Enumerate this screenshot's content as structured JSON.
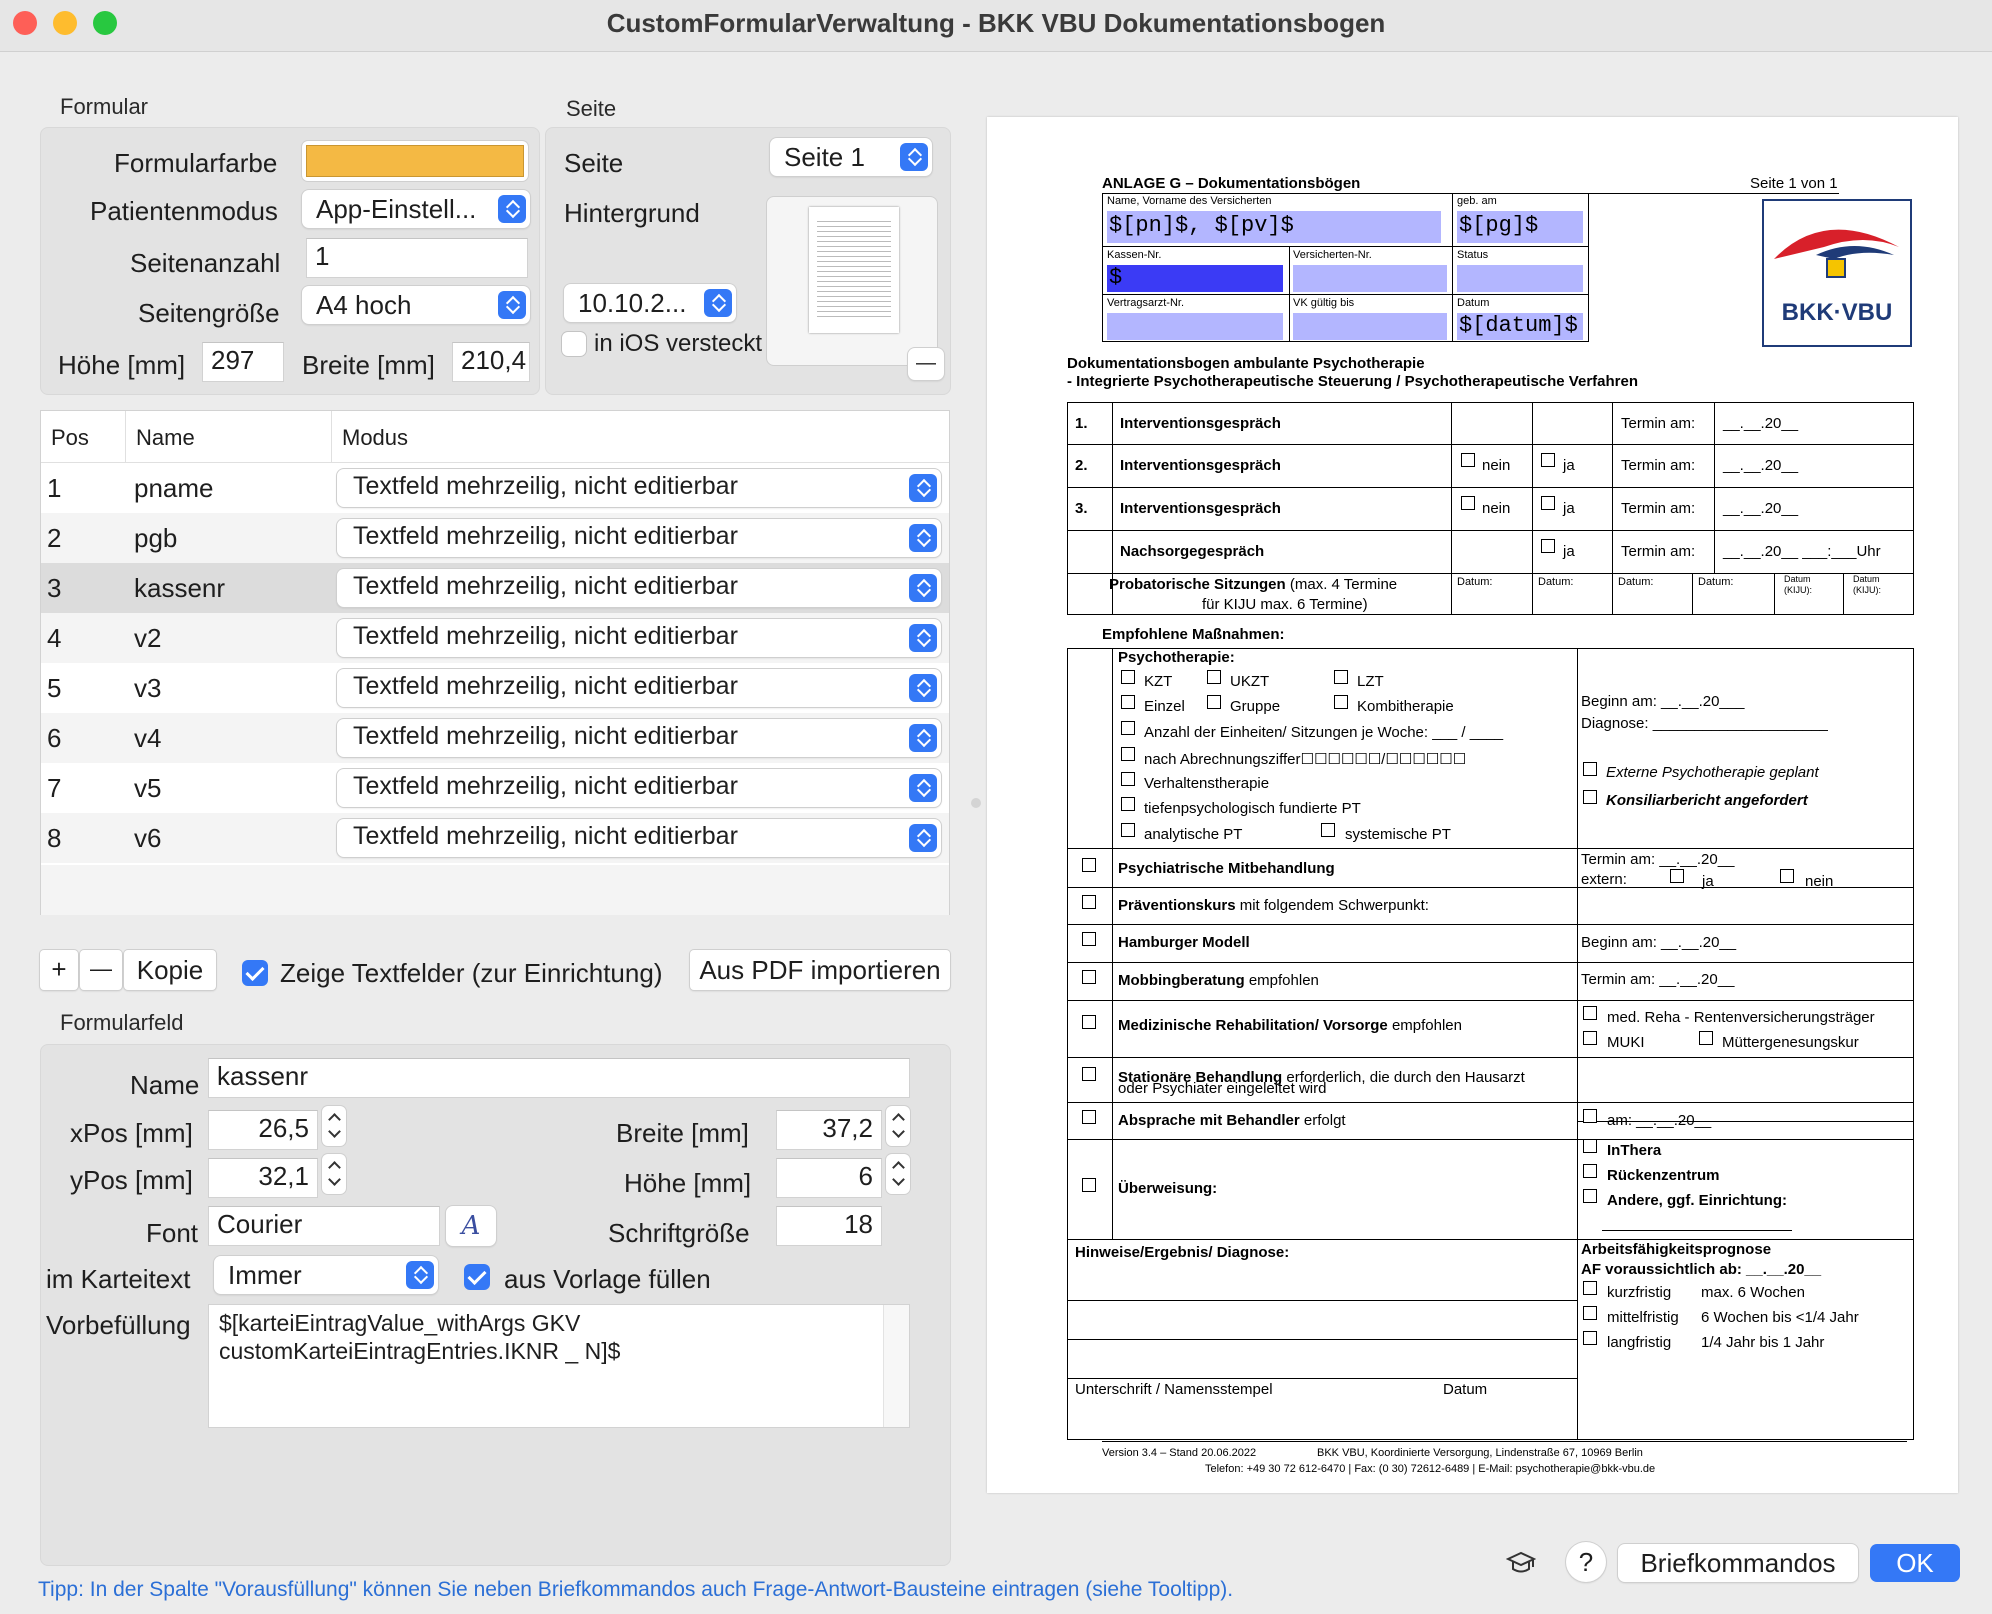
{
  "window": {
    "title": "CustomFormularVerwaltung - BKK VBU Dokumentationsbogen"
  },
  "formular": {
    "section_label": "Formular",
    "farbe_label": "Formularfarbe",
    "farbe_color": "#f4b944",
    "patientenmodus_label": "Patientenmodus",
    "patientenmodus_value": "App-Einstell...",
    "seitenanzahl_label": "Seitenanzahl",
    "seitenanzahl_value": "1",
    "seitengroesse_label": "Seitengröße",
    "seitengroesse_value": "A4 hoch",
    "hoehe_label": "Höhe [mm]",
    "hoehe_value": "297",
    "breite_label": "Breite [mm]",
    "breite_value": "210,4"
  },
  "seite": {
    "section_label": "Seite",
    "seite_label": "Seite",
    "seite_value": "Seite 1",
    "hintergrund_label": "Hintergrund",
    "date_value": "10.10.2...",
    "ios_label": "in iOS versteckt",
    "remove_symbol": "—"
  },
  "table": {
    "headers": {
      "pos": "Pos",
      "name": "Name",
      "modus": "Modus"
    },
    "rows": [
      {
        "pos": "1",
        "name": "pname",
        "modus": "Textfeld mehrzeilig, nicht editierbar"
      },
      {
        "pos": "2",
        "name": "pgb",
        "modus": "Textfeld mehrzeilig, nicht editierbar"
      },
      {
        "pos": "3",
        "name": "kassenr",
        "modus": "Textfeld mehrzeilig, nicht editierbar"
      },
      {
        "pos": "4",
        "name": "v2",
        "modus": "Textfeld mehrzeilig, nicht editierbar"
      },
      {
        "pos": "5",
        "name": "v3",
        "modus": "Textfeld mehrzeilig, nicht editierbar"
      },
      {
        "pos": "6",
        "name": "v4",
        "modus": "Textfeld mehrzeilig, nicht editierbar"
      },
      {
        "pos": "7",
        "name": "v5",
        "modus": "Textfeld mehrzeilig, nicht editierbar"
      },
      {
        "pos": "8",
        "name": "v6",
        "modus": "Textfeld mehrzeilig, nicht editierbar"
      }
    ]
  },
  "toolbar": {
    "add": "+",
    "remove": "—",
    "copy": "Kopie",
    "show_fields": "Zeige Textfelder (zur Einrichtung)",
    "import_pdf": "Aus PDF importieren"
  },
  "feld": {
    "section_label": "Formularfeld",
    "name_label": "Name",
    "name_value": "kassenr",
    "xpos_label": "xPos [mm]",
    "xpos_value": "26,5",
    "ypos_label": "yPos [mm]",
    "ypos_value": "32,1",
    "breite_label": "Breite [mm]",
    "breite_value": "37,2",
    "hoehe_label": "Höhe [mm]",
    "hoehe_value": "6",
    "font_label": "Font",
    "font_value": "Courier",
    "font_button": "A",
    "schrift_label": "Schriftgröße",
    "schrift_value": "18",
    "karteitext_label": "im Karteitext",
    "karteitext_value": "Immer",
    "vorlage_label": "aus Vorlage füllen",
    "vorbefuellung_label": "Vorbefüllung",
    "vorbefuellung_line1": "$[karteiEintragValue_withArgs GKV",
    "vorbefuellung_line2": "customKarteiEintragEntries.IKNR _ N]$"
  },
  "footer": {
    "tip": "Tipp: In der Spalte \"Vorausfüllung\" können Sie neben Briefkommandos auch Frage-Antwort-Bausteine eintragen (siehe Tooltipp).",
    "help": "?",
    "briefkommandos": "Briefkommandos",
    "ok": "OK"
  },
  "pdf": {
    "anlage": "ANLAGE G – Dokumentationsbögen",
    "seite": "Seite 1 von 1",
    "h_name": "Name, Vorname des Versicherten",
    "v_name": "$[pn]$, $[pv]$",
    "h_geb": "geb. am",
    "v_geb": "$[pg]$",
    "h_kassen": "Kassen-Nr.",
    "v_kassen": "$",
    "h_vers": "Versicherten-Nr.",
    "h_status": "Status",
    "h_vertrag": "Vertragsarzt-Nr.",
    "h_vk": "VK gültig bis",
    "h_datum": "Datum",
    "v_datum": "$[datum]$",
    "logo": "BKK·VBU",
    "doc_title1": "Dokumentationsbogen ambulante Psychotherapie",
    "doc_title2": "- Integrierte Psychotherapeutische Steuerung / Psychotherapeutische Verfahren",
    "t1_rows": [
      {
        "n": "1.",
        "t": "Interventionsgespräch"
      },
      {
        "n": "2.",
        "t": "Interventionsgespräch"
      },
      {
        "n": "3.",
        "t": "Interventionsgespräch"
      },
      {
        "n": "",
        "t": "Nachsorgegespräch"
      }
    ],
    "nein": "nein",
    "ja": "ja",
    "termin_am": "Termin am:",
    "termin_val": "__.__.20__",
    "termin_uhr": "__.__.20__ ___:___Uhr",
    "probat_b": "Probatorische Sitzungen",
    "probat_1": "(max. 4 Termine",
    "probat_2": "für KIJU max. 6 Termine)",
    "datum_c": "Datum:",
    "datum_kiju": "Datum",
    "kiju": "(KIJU):",
    "empfohlen": "Empfohlene Maßnahmen:",
    "psycho": "Psychotherapie:",
    "kzt": "KZT",
    "ukzt": "UKZT",
    "lzt": "LZT",
    "einzel": "Einzel",
    "gruppe": "Gruppe",
    "kombi": "Kombitherapie",
    "anzahl": "Anzahl der Einheiten/ Sitzungen je Woche: ___ / ____",
    "abrechnung": "nach Abrechnungsziffer☐☐☐☐☐☐/☐☐☐☐☐☐",
    "verhalten": "Verhaltenstherapie",
    "tiefen": "tiefenpsychologisch fundierte PT",
    "analyt": "analytische PT",
    "system": "systemische PT",
    "beginn": "Beginn am: __.__.20___",
    "diagnose": "Diagnose: _____________________",
    "extern": "Externe Psychotherapie geplant",
    "konsil": "Konsiliarbericht angefordert",
    "psychiat": "Psychiatrische Mitbehandlung",
    "termin_psy": "Termin am: __.__.20__",
    "extern2": "extern:",
    "praevention_b": "Präventionskurs",
    "praevention": "mit folgendem Schwerpunkt:",
    "hamburger": "Hamburger Modell",
    "beginn2": "Beginn am: __.__.20__",
    "mobbing_b": "Mobbingberatung",
    "mobbing": "empfohlen",
    "termin_mob": "Termin am:  __.__.20__",
    "medreha_b": "Medizinische Rehabilitation/ Vorsorge",
    "medreha": "empfohlen",
    "reha_rv": "med. Reha - Rentenversicherungsträger",
    "muki": "MUKI",
    "muetter": "Müttergenesungskur",
    "station_b": "Stationäre Behandlung",
    "station": "erforderlich, die durch den Hausarzt",
    "station2": "oder Psychiater eingeleitet wird",
    "absprache_b": "Absprache mit Behandler",
    "absprache": "erfolgt",
    "am": "am:      __.__.20__",
    "ueberweisung": "Überweisung:",
    "inthera": "InThera",
    "ruecken": "Rückenzentrum",
    "andere": "Andere, ggf. Einrichtung:",
    "hinweise": "Hinweise/Ergebnis/ Diagnose:",
    "arbeit": "Arbeitsfähigkeitsprognose",
    "af": "AF voraussichtlich ab:   __.__.20__",
    "kurz": "kurzfristig",
    "kurz2": "max. 6 Wochen",
    "mittel": "mittelfristig",
    "mittel2": "6 Wochen bis <1/4 Jahr",
    "lang": "langfristig",
    "lang2": "1/4 Jahr bis 1 Jahr",
    "unterschrift": "Unterschrift / Namensstempel",
    "datum_u": "Datum",
    "version": "Version 3.4 – Stand 20.06.2022",
    "adresse": "BKK VBU, Koordinierte Versorgung, Lindenstraße 67, 10969 Berlin",
    "telefon": "Telefon: +49 30 72 612-6470 | Fax: (0 30) 72612-6489 | E-Mail: psychotherapie@bkk-vbu.de"
  }
}
